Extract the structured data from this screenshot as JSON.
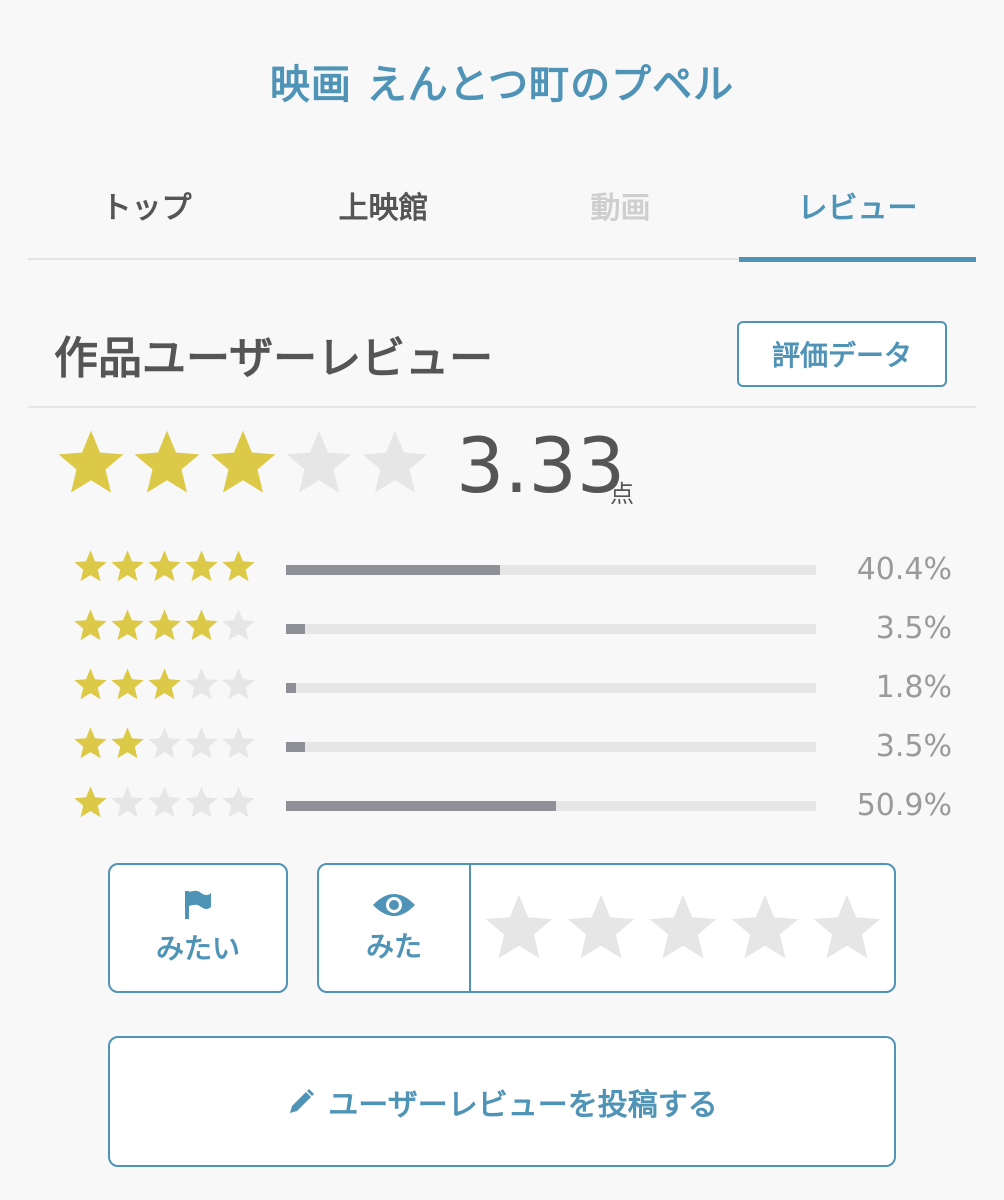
{
  "header": {
    "title": "映画 えんとつ町のプペル"
  },
  "tabs": [
    {
      "label": "トップ",
      "state": "normal"
    },
    {
      "label": "上映館",
      "state": "normal"
    },
    {
      "label": "動画",
      "state": "disabled"
    },
    {
      "label": "レビュー",
      "state": "active"
    }
  ],
  "section": {
    "title": "作品ユーザーレビュー",
    "eval_button": "評価データ"
  },
  "rating": {
    "score": "3.33",
    "unit": "点",
    "stars_filled": 3,
    "stars_total": 5
  },
  "distribution": [
    {
      "stars": 5,
      "percent_label": "40.4%",
      "fraction": 0.404
    },
    {
      "stars": 4,
      "percent_label": "3.5%",
      "fraction": 0.035
    },
    {
      "stars": 3,
      "percent_label": "1.8%",
      "fraction": 0.018
    },
    {
      "stars": 2,
      "percent_label": "3.5%",
      "fraction": 0.035
    },
    {
      "stars": 1,
      "percent_label": "50.9%",
      "fraction": 0.509
    }
  ],
  "actions": {
    "want_label": "みたい",
    "want_icon": "flag-icon",
    "seen_label": "みた",
    "seen_icon": "eye-icon",
    "rate_stars_total": 5,
    "post_label": "ユーザーレビューを投稿する",
    "post_icon": "pencil-icon"
  },
  "colors": {
    "accent": "#4f94b6",
    "star_on": "#dcc947",
    "star_off": "#e6e6e6",
    "bar_fill": "#8f9097",
    "bar_track": "#e6e6e6"
  }
}
